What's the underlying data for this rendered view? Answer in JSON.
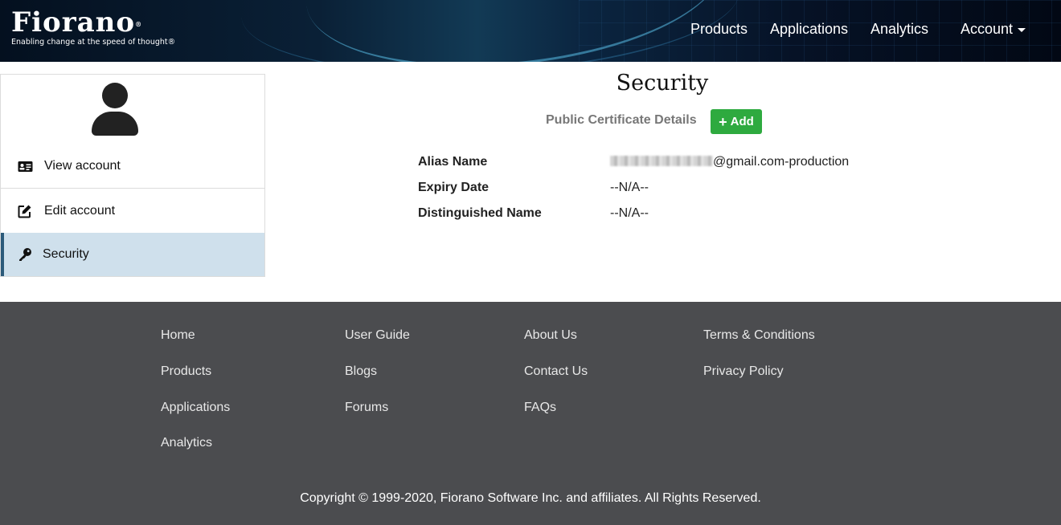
{
  "header": {
    "logo_text": "Fiorano",
    "logo_mark": "®",
    "tagline": "Enabling change at the speed of thought®",
    "nav": {
      "products": "Products",
      "applications": "Applications",
      "analytics": "Analytics",
      "account": "Account"
    }
  },
  "sidebar": {
    "avatar_icon": "user-silhouette",
    "items": [
      {
        "label": "View account",
        "icon": "id-card-icon"
      },
      {
        "label": "Edit account",
        "icon": "edit-icon"
      },
      {
        "label": "Security",
        "icon": "key-icon",
        "active": true
      }
    ]
  },
  "main": {
    "title": "Security",
    "section_label": "Public Certificate Details",
    "add_button": "Add",
    "fields": [
      {
        "label": "Alias Name",
        "value_suffix": "@gmail.com-production",
        "redacted": true
      },
      {
        "label": "Expiry Date",
        "value": "--N/A--"
      },
      {
        "label": "Distinguished Name",
        "value": "--N/A--"
      }
    ]
  },
  "footer": {
    "col1": [
      "Home",
      "Products",
      "Applications",
      "Analytics"
    ],
    "col2": [
      "User Guide",
      "Blogs",
      "Forums"
    ],
    "col3": [
      "About Us",
      "Contact Us",
      "FAQs"
    ],
    "col4": [
      "Terms & Conditions",
      "Privacy Policy"
    ],
    "copyright": "Copyright © 1999-2020, Fiorano Software Inc. and affiliates. All Rights Reserved."
  },
  "colors": {
    "add_button": "#2eaa3f",
    "active_item_bg": "#cfe0ec",
    "active_item_border": "#2c5a7a",
    "footer_bg": "#4b4c4f"
  }
}
